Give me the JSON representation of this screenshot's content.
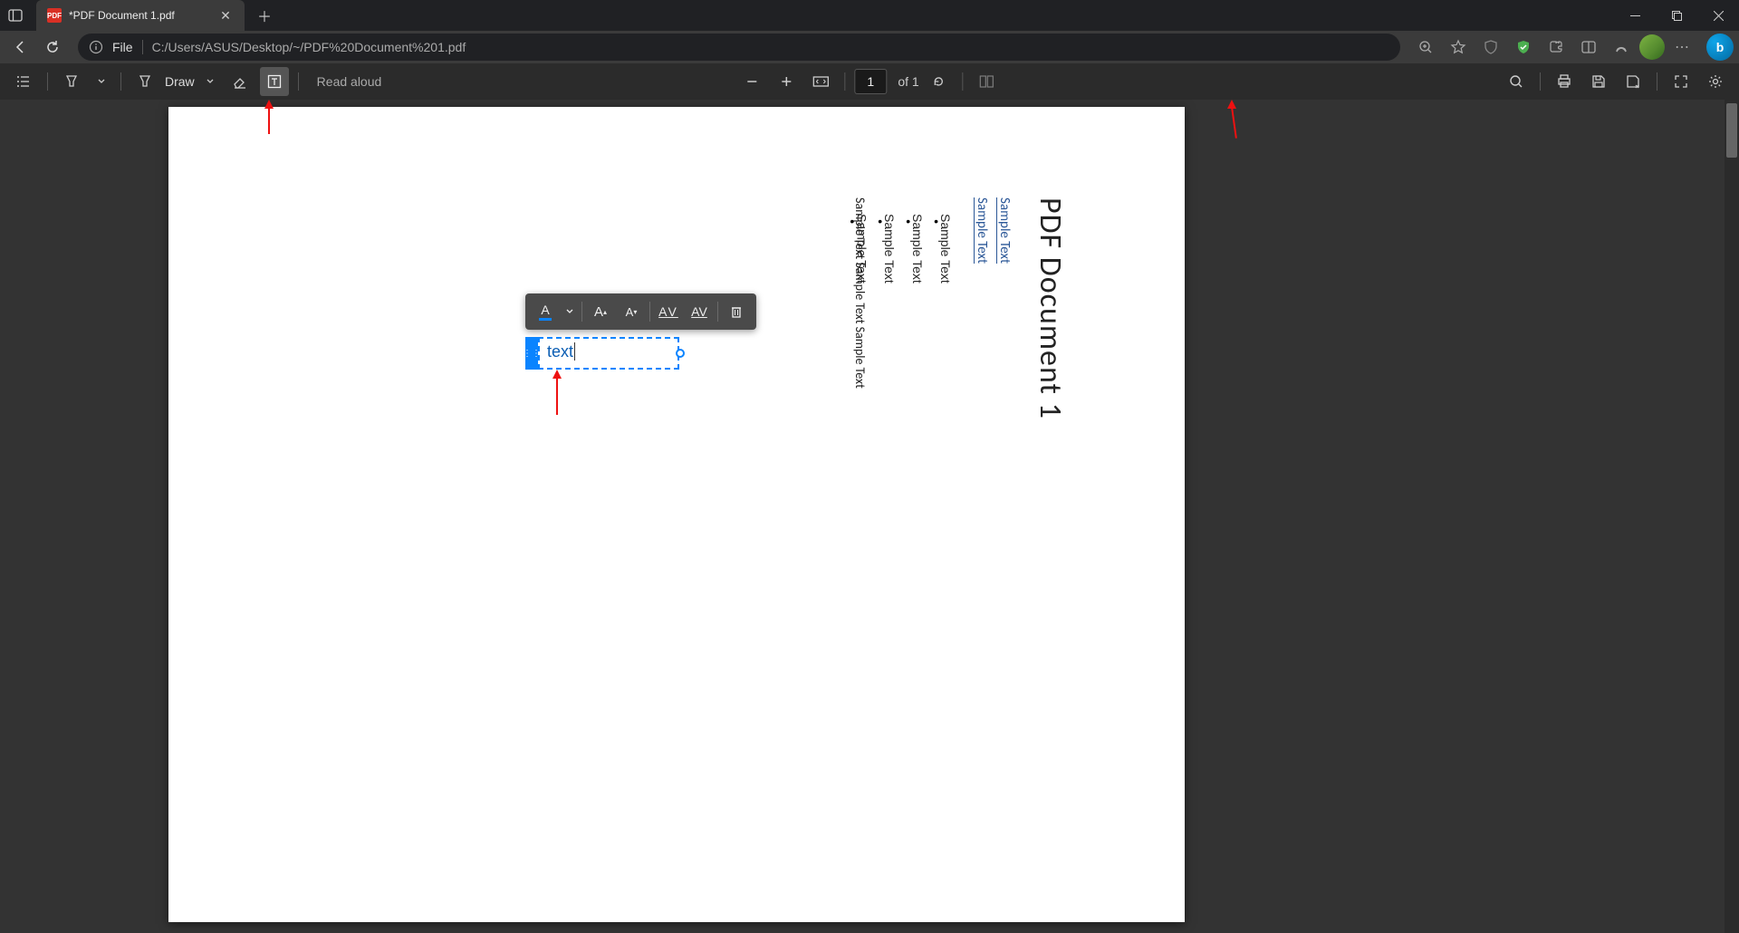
{
  "tab": {
    "title": "*PDF Document 1.pdf",
    "favicon_text": "PDF"
  },
  "url": {
    "scheme": "File",
    "path": "C:/Users/ASUS/Desktop/~/PDF%20Document%201.pdf"
  },
  "pdf_toolbar": {
    "draw": "Draw",
    "read_aloud": "Read aloud",
    "page_current": "1",
    "page_total": "of 1"
  },
  "annotation": {
    "text_value": "text"
  },
  "doc": {
    "title": "PDF Document 1",
    "link1": "Sample Text",
    "link2": "Sample Text",
    "bullets": [
      "Sample Text",
      "Sample Text",
      "Sample Text",
      "Sample Text"
    ],
    "paragraph": "Sample Text Sample Text Sample Text"
  }
}
